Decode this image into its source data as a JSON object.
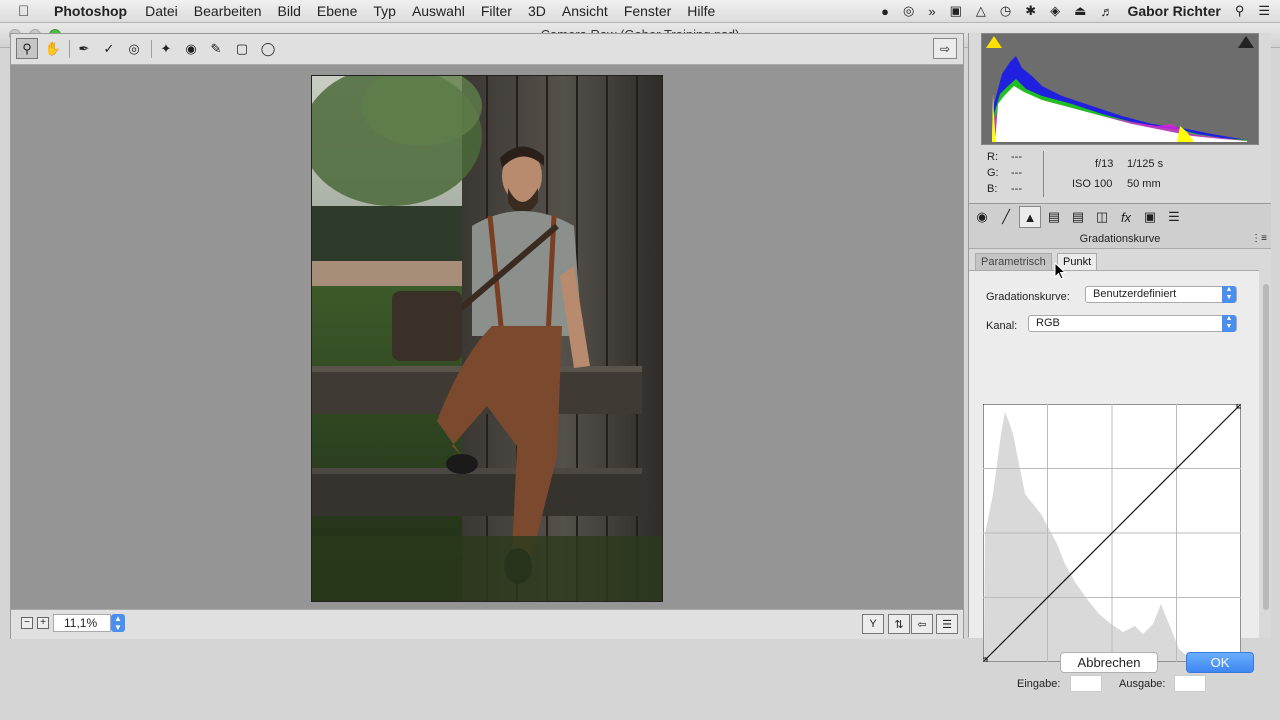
{
  "menubar": {
    "app_name": "Photoshop",
    "menus": [
      "Datei",
      "Bearbeiten",
      "Bild",
      "Ebene",
      "Typ",
      "Auswahl",
      "Filter",
      "3D",
      "Ansicht",
      "Fenster",
      "Hilfe"
    ],
    "user": "Gabor Richter"
  },
  "window": {
    "title": "Camera Raw (Gabor Training.psd)"
  },
  "statusbar": {
    "zoom": "11,1%"
  },
  "info": {
    "r_label": "R:",
    "r_value": "---",
    "g_label": "G:",
    "g_value": "---",
    "b_label": "B:",
    "b_value": "---",
    "aperture": "f/13",
    "shutter": "1/125 s",
    "iso": "ISO 100",
    "focal_length": "50 mm"
  },
  "panel": {
    "title": "Gradationskurve",
    "subtab_parametric": "Parametrisch",
    "subtab_point": "Punkt",
    "curve_label": "Gradationskurve:",
    "curve_value": "Benutzerdefiniert",
    "channel_label": "Kanal:",
    "channel_value": "RGB",
    "input_label": "Eingabe:",
    "output_label": "Ausgabe:"
  },
  "buttons": {
    "cancel": "Abbrechen",
    "ok": "OK"
  },
  "colors": {
    "accent": "#4a8ef0",
    "shadow_clip": "#ffe000"
  }
}
